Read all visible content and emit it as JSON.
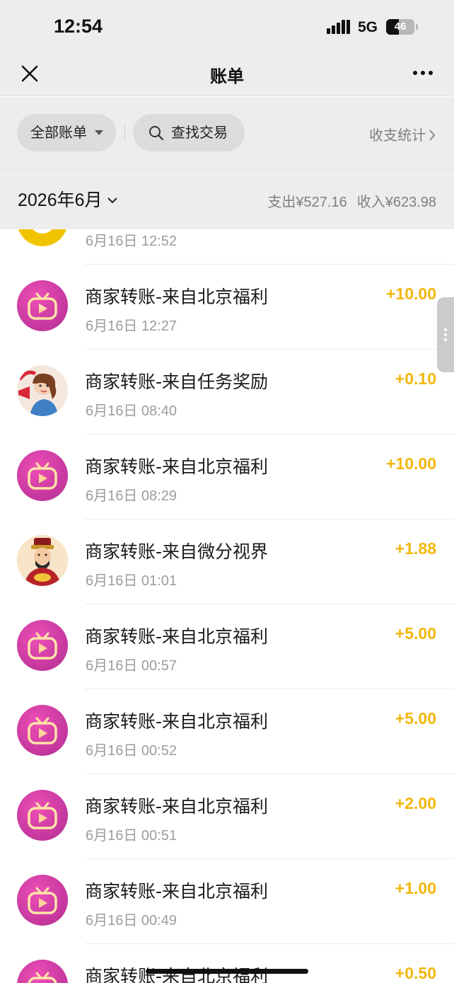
{
  "status_bar": {
    "time": "12:54",
    "network": "5G",
    "battery": "46",
    "battery_level": 0.46
  },
  "nav": {
    "title": "账单",
    "close_icon": "close-icon",
    "more_icon": "more-icon"
  },
  "filters": {
    "all_bills": "全部账单",
    "search": "查找交易",
    "stats": "收支统计"
  },
  "month": {
    "label": "2026年6月",
    "expense": "支出¥527.16",
    "income": "收入¥623.98"
  },
  "colors": {
    "amount": "#f2b70c",
    "avatar_pink": "#c93aa1",
    "background": "#ededed"
  },
  "transactions": [
    {
      "title": "",
      "time": "6月16日 12:52",
      "amount": "",
      "avatar": "yellow-avatar"
    },
    {
      "title": "商家转账-来自北京福利",
      "time": "6月16日 12:27",
      "amount": "+10.00",
      "avatar": "tv-app-icon"
    },
    {
      "title": "商家转账-来自任务奖励",
      "time": "6月16日 08:40",
      "amount": "+0.10",
      "avatar": "cartoon-woman-avatar"
    },
    {
      "title": "商家转账-来自北京福利",
      "time": "6月16日 08:29",
      "amount": "+10.00",
      "avatar": "tv-app-icon"
    },
    {
      "title": "商家转账-来自微分视界",
      "time": "6月16日 01:01",
      "amount": "+1.88",
      "avatar": "wealth-god-avatar"
    },
    {
      "title": "商家转账-来自北京福利",
      "time": "6月16日 00:57",
      "amount": "+5.00",
      "avatar": "tv-app-icon"
    },
    {
      "title": "商家转账-来自北京福利",
      "time": "6月16日 00:52",
      "amount": "+5.00",
      "avatar": "tv-app-icon"
    },
    {
      "title": "商家转账-来自北京福利",
      "time": "6月16日 00:51",
      "amount": "+2.00",
      "avatar": "tv-app-icon"
    },
    {
      "title": "商家转账-来自北京福利",
      "time": "6月16日 00:49",
      "amount": "+1.00",
      "avatar": "tv-app-icon"
    },
    {
      "title": "商家转账-来自北京福利",
      "time": "",
      "amount": "+0.50",
      "avatar": "tv-app-icon"
    }
  ]
}
